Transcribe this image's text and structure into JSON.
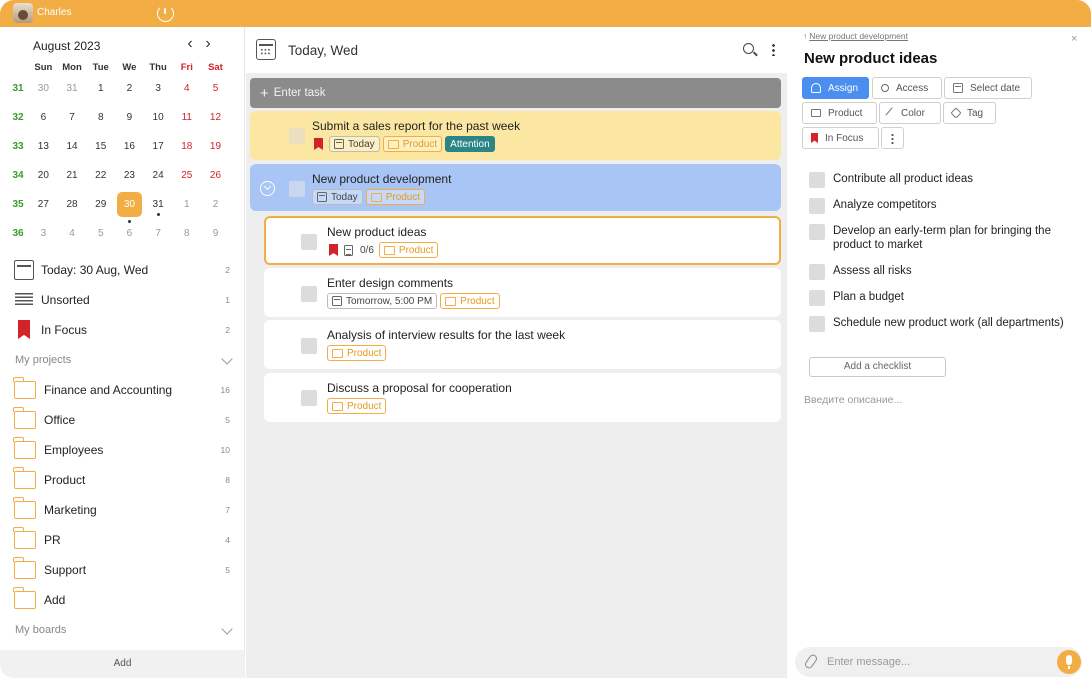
{
  "topbar": {
    "user_name": "Charles"
  },
  "calendar": {
    "month_label": "August 2023",
    "weekdays": [
      "Sun",
      "Mon",
      "Tue",
      "We",
      "Thu",
      "Fri",
      "Sat"
    ],
    "weeks": [
      {
        "num": "31",
        "days": [
          "30",
          "31",
          "1",
          "2",
          "3",
          "4",
          "5"
        ]
      },
      {
        "num": "32",
        "days": [
          "6",
          "7",
          "8",
          "9",
          "10",
          "11",
          "12"
        ]
      },
      {
        "num": "33",
        "days": [
          "13",
          "14",
          "15",
          "16",
          "17",
          "18",
          "19"
        ]
      },
      {
        "num": "34",
        "days": [
          "20",
          "21",
          "22",
          "23",
          "24",
          "25",
          "26"
        ]
      },
      {
        "num": "35",
        "days": [
          "27",
          "28",
          "29",
          "30",
          "31",
          "1",
          "2"
        ]
      },
      {
        "num": "36",
        "days": [
          "3",
          "4",
          "5",
          "6",
          "7",
          "8",
          "9"
        ]
      }
    ]
  },
  "nav": {
    "today": {
      "label": "Today: 30 Aug, Wed",
      "count": "2"
    },
    "unsorted": {
      "label": "Unsorted",
      "count": "1"
    },
    "focus": {
      "label": "In Focus",
      "count": "2"
    }
  },
  "projects": {
    "header": "My projects",
    "items": [
      {
        "label": "Finance and Accounting",
        "count": "16"
      },
      {
        "label": "Office",
        "count": "5"
      },
      {
        "label": "Employees",
        "count": "10"
      },
      {
        "label": "Product",
        "count": "8"
      },
      {
        "label": "Marketing",
        "count": "7"
      },
      {
        "label": "PR",
        "count": "4"
      },
      {
        "label": "Support",
        "count": "5"
      },
      {
        "label": "Add",
        "count": ""
      }
    ]
  },
  "boards": {
    "header": "My boards"
  },
  "sidebar_add": "Add",
  "middle": {
    "title": "Today, Wed",
    "enter_task": "Enter task",
    "tasks": [
      {
        "title": "Submit a sales report for the past week",
        "date": "Today",
        "project": "Product",
        "badge": "Attention"
      },
      {
        "title": "New product development",
        "date": "Today",
        "project": "Product"
      },
      {
        "title": "New product ideas",
        "subtasks": "0/6",
        "project": "Product"
      },
      {
        "title": "Enter design comments",
        "date": "Tomorrow, 5:00 PM",
        "project": "Product"
      },
      {
        "title": "Analysis of interview results for the last week",
        "project": "Product"
      },
      {
        "title": "Discuss a proposal for cooperation",
        "project": "Product"
      }
    ]
  },
  "detail": {
    "breadcrumb": "New product development",
    "title": "New product ideas",
    "buttons": {
      "assign": "Assign",
      "access": "Access",
      "select_date": "Select date",
      "product": "Product",
      "color": "Color",
      "tag": "Tag",
      "focus": "In Focus"
    },
    "checklist": [
      "Contribute all product ideas",
      "Analyze competitors",
      "Develop an early-term plan for bringing the product to market",
      "Assess all risks",
      "Plan a budget",
      "Schedule new product work (all departments)"
    ],
    "add_checklist": "Add a checklist",
    "description_placeholder": "Введите описание...",
    "message_placeholder": "Enter message..."
  },
  "colors": {
    "accent": "#f2ad45",
    "highlight_yellow": "#fbe7a1",
    "highlight_blue": "#a9c5f5",
    "primary_blue": "#4a8ff0",
    "attention_teal": "#2b8585",
    "weekend_red": "#d2232a",
    "week_green": "#3a9b2c"
  }
}
